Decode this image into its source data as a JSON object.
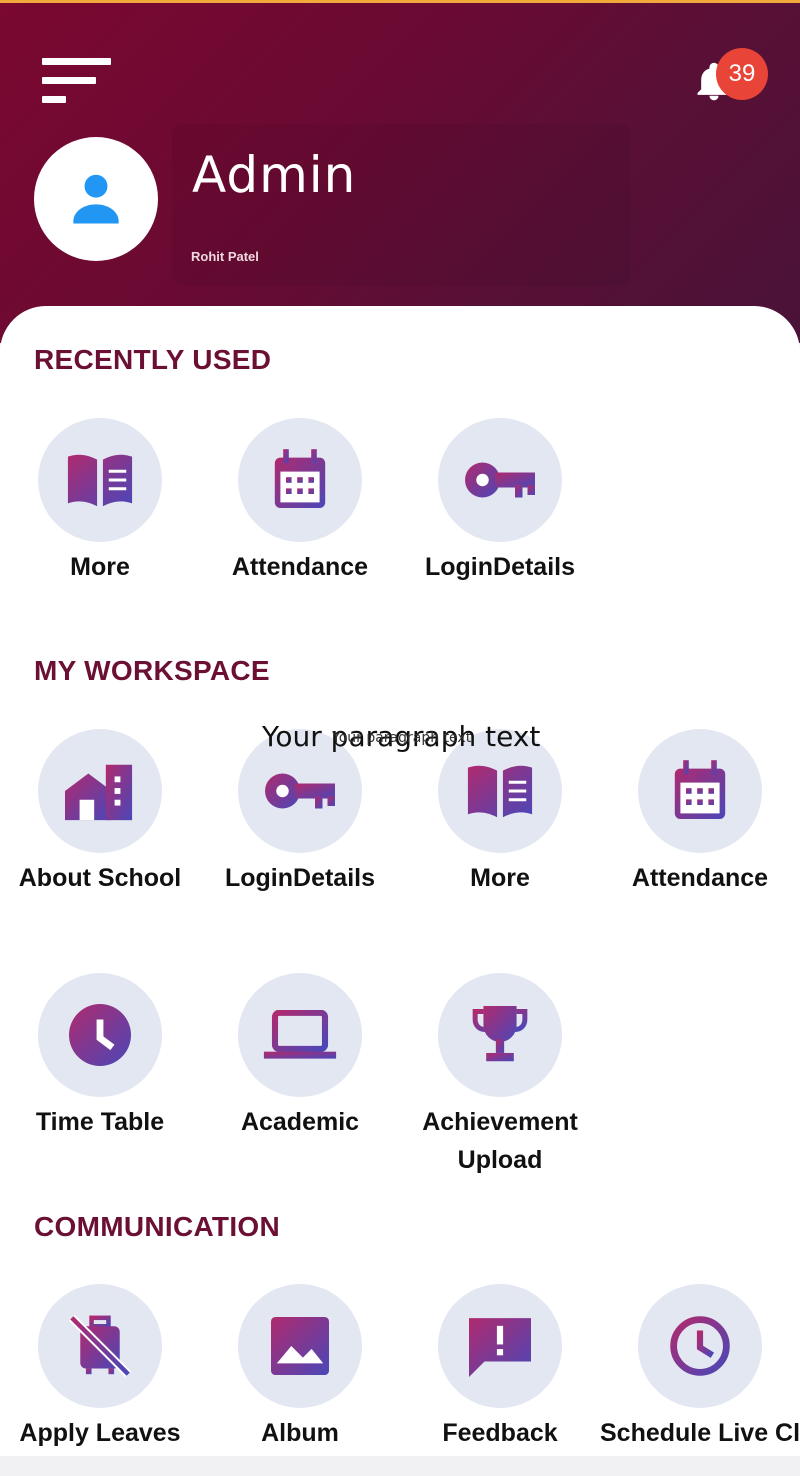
{
  "header": {
    "badge_count": "39",
    "role": "Admin",
    "user_name": "Rohit Patel"
  },
  "sections": {
    "recent": "RECENTLY USED",
    "workspace": "MY WORKSPACE",
    "communication": "COMMUNICATION"
  },
  "recent": [
    "More",
    "Attendance",
    "LoginDetails"
  ],
  "workspace": [
    "About School",
    "LoginDetails",
    "More",
    "Attendance",
    "Time Table",
    "Academic",
    "Achievement Upload"
  ],
  "communication": [
    "Apply Leaves",
    "Album",
    "Feedback",
    "Schedule Live Cl"
  ],
  "overlay": {
    "text_large": "Your paragraph text",
    "text_small": "Your paragraph text"
  },
  "icons": {
    "gradient_start": "#b02a6e",
    "gradient_end": "#4a47b8",
    "bell": "bell-icon",
    "menu": "menu-icon"
  }
}
